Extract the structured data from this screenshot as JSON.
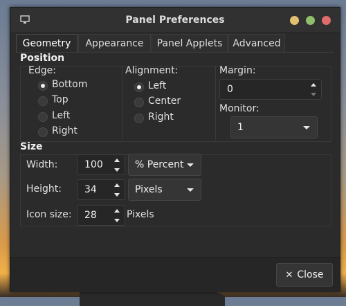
{
  "window": {
    "title": "Panel Preferences"
  },
  "tabs": [
    {
      "label": "Geometry"
    },
    {
      "label": "Appearance"
    },
    {
      "label": "Panel Applets"
    },
    {
      "label": "Advanced"
    }
  ],
  "position": {
    "title": "Position",
    "edge": {
      "label": "Edge:",
      "options": [
        "Bottom",
        "Top",
        "Left",
        "Right"
      ],
      "selected": "Bottom"
    },
    "alignment": {
      "label": "Alignment:",
      "options": [
        "Left",
        "Center",
        "Right"
      ],
      "selected": "Left"
    },
    "margin": {
      "label": "Margin:",
      "value": "0"
    },
    "monitor": {
      "label": "Monitor:",
      "value": "1"
    }
  },
  "size": {
    "title": "Size",
    "width": {
      "label": "Width:",
      "value": "100",
      "unit": "% Percent"
    },
    "height": {
      "label": "Height:",
      "value": "34",
      "unit": "Pixels"
    },
    "icon_size": {
      "label": "Icon size:",
      "value": "28",
      "unit": "Pixels"
    }
  },
  "footer": {
    "close_label": "Close",
    "close_icon": "close-icon"
  },
  "colors": {
    "titlebar": "#313131",
    "window_bg": "#2b2b2b",
    "min": "#e3c070",
    "max": "#8fbf6a",
    "close": "#e06c6c"
  }
}
